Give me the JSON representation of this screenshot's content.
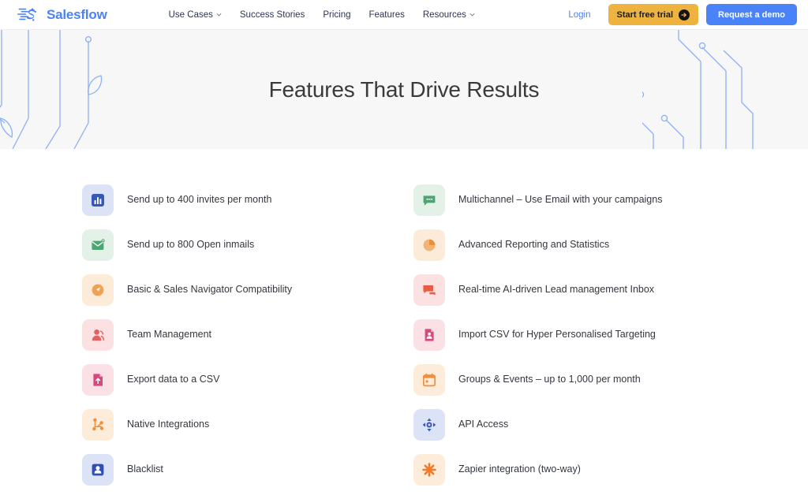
{
  "brand": {
    "name": "Salesflow",
    "logo_icon": "salesflow-s-logo",
    "accent_blue": "#4a82f7"
  },
  "nav": {
    "links": [
      {
        "label": "Use Cases",
        "has_caret": true
      },
      {
        "label": "Success Stories",
        "has_caret": false
      },
      {
        "label": "Pricing",
        "has_caret": false
      },
      {
        "label": "Features",
        "has_caret": false
      },
      {
        "label": "Resources",
        "has_caret": true
      }
    ],
    "login_label": "Login",
    "trial_button": {
      "label": "Start free trial",
      "icon": "arrow-right-circle-icon",
      "color": "#eeb33f"
    },
    "demo_button": {
      "label": "Request a demo",
      "color": "#4a82f7"
    }
  },
  "hero": {
    "title": "Features That Drive Results",
    "background": "#f7f7f7",
    "decoration": "circuit-trace-pattern",
    "decoration_color": "#8cb0f2"
  },
  "features": {
    "left_column": [
      {
        "label": "Send up to 400 invites per month",
        "icon": "bar-chart-icon",
        "tile_bg": "#dde3f7",
        "icon_color": "#3558b8"
      },
      {
        "label": "Send up to 800 Open inmails",
        "icon": "mail-check-icon",
        "tile_bg": "#e3f1e8",
        "icon_color": "#4fa572"
      },
      {
        "label": "Basic & Sales Navigator Compatibility",
        "icon": "compass-navigator-icon",
        "tile_bg": "#fcebd8",
        "icon_color": "#efa254"
      },
      {
        "label": "Team Management",
        "icon": "team-user-icon",
        "tile_bg": "#fbe1e1",
        "icon_color": "#e56060"
      },
      {
        "label": "Export data to a CSV",
        "icon": "file-upload-icon",
        "tile_bg": "#fbe0e6",
        "icon_color": "#d44a7e"
      },
      {
        "label": "Native Integrations",
        "icon": "integration-nodes-icon",
        "tile_bg": "#fdecd9",
        "icon_color": "#ef8f3c"
      },
      {
        "label": "Blacklist",
        "icon": "contact-card-icon",
        "tile_bg": "#dde3f7",
        "icon_color": "#2f4fb5"
      }
    ],
    "right_column": [
      {
        "label": "Multichannel – Use Email with your campaigns",
        "icon": "chat-bubble-icon",
        "tile_bg": "#e3f1e8",
        "icon_color": "#4fa572"
      },
      {
        "label": "Advanced Reporting and Statistics",
        "icon": "pie-chart-icon",
        "tile_bg": "#fcebd8",
        "icon_color": "#efa254"
      },
      {
        "label": "Real-time AI-driven Lead management Inbox",
        "icon": "chat-bubbles-icon",
        "tile_bg": "#fbe1e1",
        "icon_color": "#e85c44"
      },
      {
        "label": "Import CSV for Hyper Personalised Targeting",
        "icon": "file-download-icon",
        "tile_bg": "#fbe0e6",
        "icon_color": "#d44a7e"
      },
      {
        "label": "Groups & Events – up to 1,000 per month",
        "icon": "calendar-icon",
        "tile_bg": "#fdecd9",
        "icon_color": "#ef8f3c"
      },
      {
        "label": "API Access",
        "icon": "move-arrows-icon",
        "tile_bg": "#dde3f7",
        "icon_color": "#3558b8"
      },
      {
        "label": "Zapier integration (two-way)",
        "icon": "zapier-asterisk-icon",
        "tile_bg": "#fdecd9",
        "icon_color": "#ef7b28"
      }
    ]
  }
}
